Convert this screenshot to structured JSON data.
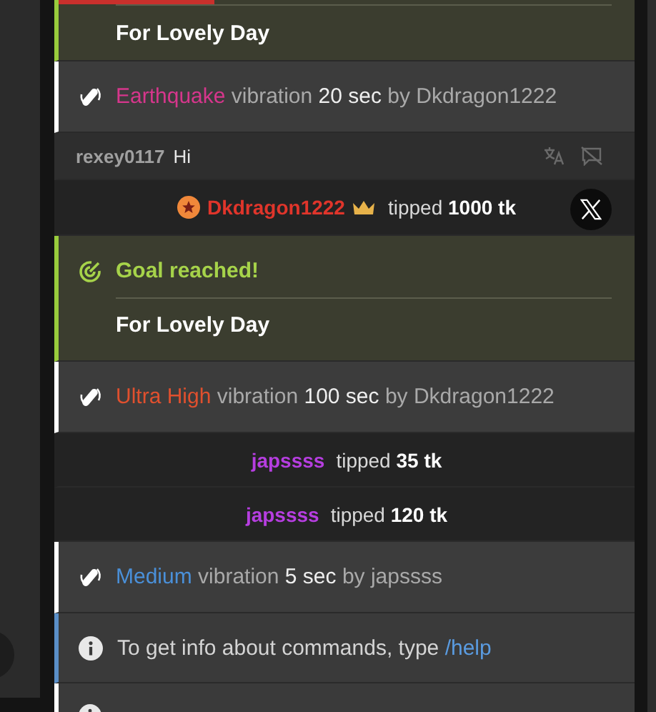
{
  "messages": [
    {
      "kind": "goal",
      "level": 0.27,
      "description": "For Lovely Day"
    },
    {
      "kind": "vibration",
      "name": "Earthquake",
      "color": "#d6368c",
      "word": "vibration",
      "duration": "20 sec",
      "by": "by",
      "user": "Dkdragon1222"
    },
    {
      "kind": "chat",
      "user": "rexey0117",
      "text": "Hi"
    },
    {
      "kind": "tip",
      "user": "Dkdragon1222",
      "color": "#e0352b",
      "badge": true,
      "crown": true,
      "verb": "tipped",
      "amount": "1000 tk",
      "x_button": true
    },
    {
      "kind": "goal",
      "heading": "Goal reached!",
      "description": "For Lovely Day"
    },
    {
      "kind": "vibration",
      "name": "Ultra High",
      "color": "#e0502e",
      "word": "vibration",
      "duration": "100 sec",
      "by": "by",
      "user": "Dkdragon1222"
    },
    {
      "kind": "tip",
      "user": "japssss",
      "color": "#b63ee0",
      "badge": false,
      "crown": false,
      "verb": "tipped",
      "amount": "35 tk",
      "x_button": false
    },
    {
      "kind": "tip",
      "user": "japssss",
      "color": "#b63ee0",
      "badge": false,
      "crown": false,
      "verb": "tipped",
      "amount": "120 tk",
      "x_button": false
    },
    {
      "kind": "vibration",
      "name": "Medium",
      "color": "#4a90d9",
      "word": "vibration",
      "duration": "5 sec",
      "by": "by",
      "user": "japssss"
    },
    {
      "kind": "info",
      "text": "To get info about commands, type",
      "command": "/help"
    },
    {
      "kind": "notice"
    }
  ]
}
